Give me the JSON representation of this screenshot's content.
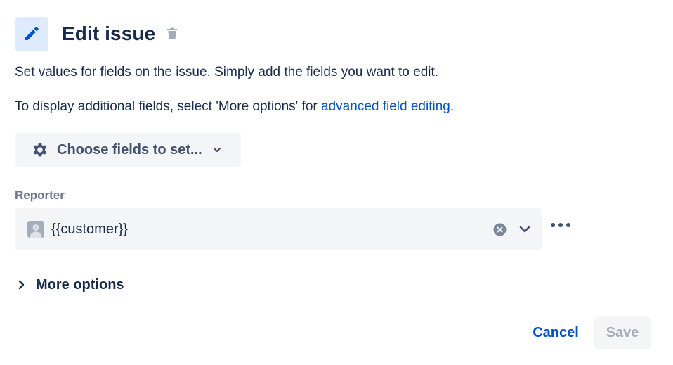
{
  "header": {
    "title": "Edit issue",
    "icon": "pencil-icon",
    "delete_icon": "trash-icon"
  },
  "description": {
    "line1": "Set values for fields on the issue. Simply add the fields you want to edit.",
    "line2_prefix": "To display additional fields, select 'More options' for ",
    "line2_link": "advanced field editing",
    "line2_suffix": "."
  },
  "choose_fields": {
    "label": "Choose fields to set...",
    "icon": "gear-icon"
  },
  "reporter": {
    "label": "Reporter",
    "value": "{{customer}}",
    "avatar": "default-avatar"
  },
  "more_options": {
    "label": "More options"
  },
  "footer": {
    "cancel_label": "Cancel",
    "save_label": "Save"
  },
  "colors": {
    "accent": "#0052cc",
    "text": "#172b4d",
    "subtle_text": "#6b778c",
    "field_bg": "#f4f5f7",
    "icon_box_bg": "#deebff",
    "disabled_text": "#a5adba"
  }
}
